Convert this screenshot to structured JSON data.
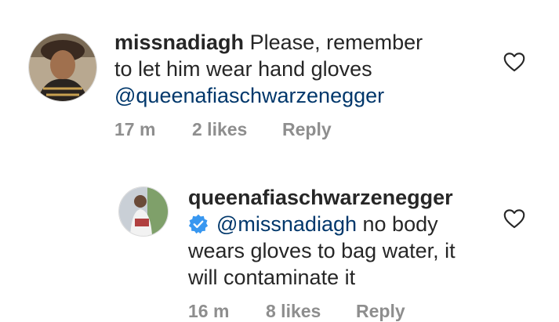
{
  "comments": [
    {
      "username": "missnadiagh",
      "text_line1": "Please, remember",
      "text_line2": "to let him wear hand gloves",
      "mention": "@queenafiaschwarzenegger",
      "time": "17 m",
      "likes": "2 likes",
      "reply": "Reply"
    },
    {
      "username": "queenafiaschwarzenegger",
      "verified": true,
      "mention": "@missnadiagh",
      "text_line1": "no body",
      "text_line2": "wears gloves to bag water, it",
      "text_line3": "will contaminate it",
      "time": "16 m",
      "likes": "8 likes",
      "reply": "Reply"
    }
  ],
  "colors": {
    "text": "#262626",
    "muted": "#8e8e8e",
    "mention": "#00376b",
    "verified": "#3897f0"
  },
  "icons": [
    "heart-icon",
    "verified-badge-icon"
  ]
}
